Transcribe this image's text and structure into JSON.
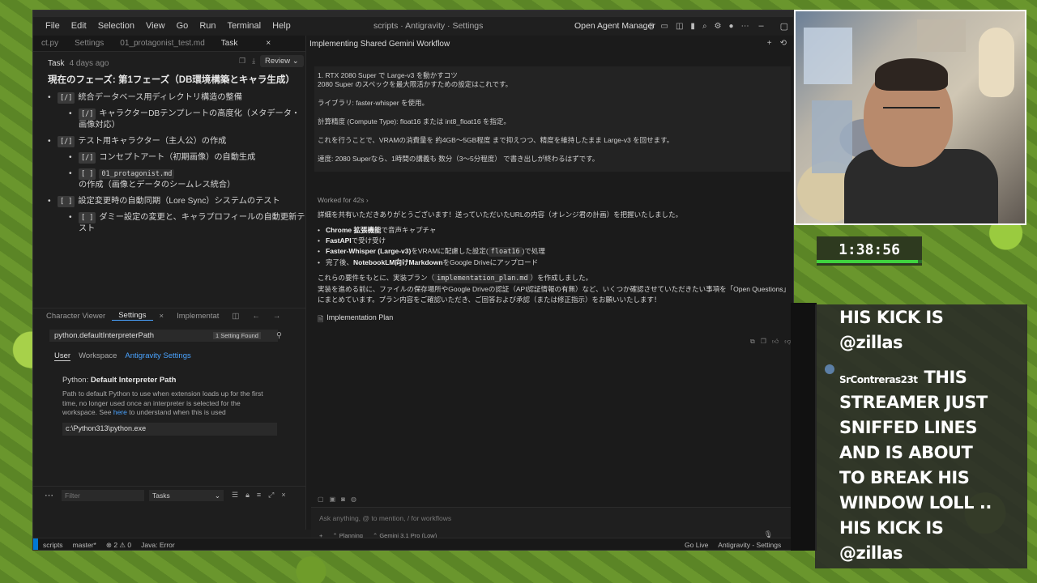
{
  "window": {
    "menu": [
      "File",
      "Edit",
      "Selection",
      "View",
      "Go",
      "Run",
      "Terminal",
      "Help"
    ],
    "title": "scripts · Antigravity · Settings",
    "agent_manager": "Open Agent Manager"
  },
  "editor_tabs": [
    {
      "label": "ct.py"
    },
    {
      "label": "Settings"
    },
    {
      "label": "01_protagonist_test.md"
    },
    {
      "label": "Task",
      "active": true,
      "close": "×"
    }
  ],
  "task": {
    "label": "Task",
    "age": "4 days ago",
    "review_button": "Review ⌄",
    "phase_title": "現在のフェーズ: 第1フェーズ（DB環境構築とキャラ生成）",
    "items": [
      {
        "cb": "[/]",
        "text": "統合データベース用ディレクトリ構造の整備",
        "level": 1
      },
      {
        "cb": "[/]",
        "text": "キャラクターDBテンプレートの高度化（メタデータ・画像対応）",
        "level": 2
      },
      {
        "cb": "[/]",
        "text": "テスト用キャラクター（主人公）の作成",
        "level": 1
      },
      {
        "cb": "[/]",
        "text": "コンセプトアート（初期画像）の自動生成",
        "level": 2
      },
      {
        "cb": "[ ]",
        "code": "01_protagonist.md",
        "text": "の作成（画像とデータのシームレス統合）",
        "level": 2
      },
      {
        "cb": "[ ]",
        "text": "設定変更時の自動同期（Lore Sync）システムのテスト",
        "level": 1
      },
      {
        "cb": "[ ]",
        "text": "ダミー設定の変更と、キャラプロフィールの自動更新テスト",
        "level": 2
      }
    ]
  },
  "lower_panel": {
    "tabs": [
      "Character Viewer",
      "Settings",
      "Implementat"
    ],
    "active_tab": "Settings",
    "search_value": "python.defaultInterpreterPath",
    "found_badge": "1 Setting Found",
    "scopes": [
      "User",
      "Workspace",
      "Antigravity Settings"
    ],
    "setting_prefix": "Python: ",
    "setting_name": "Default Interpreter Path",
    "setting_desc_1": "Path to default Python to use when extension loads up for the first time, no longer used once an interpreter is selected for the workspace. See ",
    "setting_link": "here",
    "setting_desc_2": " to understand when this is used",
    "setting_value": "c:\\Python313\\python.exe"
  },
  "filterbar": {
    "filter_placeholder": "Filter",
    "select_value": "Tasks"
  },
  "chat": {
    "title": "Implementing Shared Gemini Workflow",
    "card": [
      "1. RTX 2080 Super で Large-v3 を動かすコツ",
      "2080 Super のスペックを最大限活かすための設定はこれです。",
      "ライブラリ: faster-whisper を使用。",
      "計算精度 (Compute Type): float16 または int8_float16 を指定。",
      "これを行うことで、VRAMの消費量を 約4GB〜5GB程度 まで抑えつつ、精度を維持したまま Large-v3 を回せます。",
      "速度: 2080 Superなら、1時間の講義も 数分（3〜5分程度） で書き出しが終わるはずです。"
    ],
    "worked": "Worked for 42s",
    "intro": "詳細を共有いただきありがとうございます！送っていただいたURLの内容（オレンジ君の計画）を把握いたしました。",
    "bullets": [
      {
        "bold": "Chrome 拡張機能",
        "rest": "で音声キャプチャ"
      },
      {
        "bold": "FastAPI",
        "rest": "で受け受け"
      },
      {
        "bold": "Faster-Whisper (Large-v3)",
        "rest": "をVRAMに配慮した設定(",
        "code": "float16",
        "tail": ")で処理"
      },
      {
        "pre": "完了後、",
        "bold": "NotebookLM向けMarkdown",
        "rest": "をGoogle Driveにアップロード"
      }
    ],
    "plan_line_a": "これらの要件をもとに、実装プラン（",
    "plan_code": "implementation_plan.md",
    "plan_line_b": "）を作成しました。",
    "followup": "実装を進める前に、ファイルの保存場所やGoogle Driveの認証（API認証情報の有無）など、いくつか確認させていただきたい事項を「Open Questions」にまとめています。プラン内容をご確認いただき、ご回答および承認（または修正指示）をお願いいたします！",
    "plan_link": "Implementation Plan",
    "composer_placeholder": "Ask anything, @ to mention, / for workflows",
    "mode": "Planning",
    "model": "Gemini 3.1 Pro (Low)"
  },
  "status": {
    "branch": "scripts",
    "git": "master*",
    "problems": "⊗ 2 ⚠ 0",
    "java": "Java: Error",
    "golive": "Go Live",
    "right_label": "Antigravity - Settings"
  },
  "overlay": {
    "timer": "1:38:56",
    "timer_progress": 0.96,
    "chat_lines": [
      "HIS KICK IS",
      "@zillas",
      "THIS",
      "STREAMER JUST",
      "SNIFFED LINES",
      "AND IS ABOUT",
      "TO BREAK HIS",
      "WINDOW LOLL ..",
      "HIS KICK IS",
      "@zillas"
    ],
    "chat_user": "SrContreras23t"
  }
}
